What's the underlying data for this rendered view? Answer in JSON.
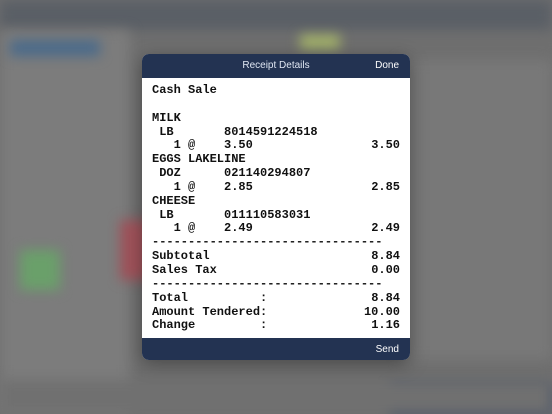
{
  "dialog": {
    "title": "Receipt Details",
    "done_label": "Done",
    "send_label": "Send"
  },
  "receipt": {
    "heading": "Cash Sale",
    "items": [
      {
        "name": "MILK",
        "unit_line": " LB       8014591224518",
        "qty_line": "   1 @    3.50",
        "total": "3.50"
      },
      {
        "name": "EGGS LAKELINE",
        "unit_line": " DOZ      021140294807",
        "qty_line": "   1 @    2.85",
        "total": "2.85"
      },
      {
        "name": "CHEESE",
        "unit_line": " LB       011110583031",
        "qty_line": "   1 @    2.49",
        "total": "2.49"
      }
    ],
    "separator": "--------------------------------",
    "subtotal_label": "Subtotal",
    "subtotal_value": "8.84",
    "tax_label": "Sales Tax",
    "tax_value": "0.00",
    "total_label": "Total          :",
    "total_value": "8.84",
    "tendered_label": "Amount Tendered:",
    "tendered_value": "10.00",
    "change_label": "Change         :",
    "change_value": "1.16"
  },
  "colors": {
    "header": "#233352",
    "body": "#ffffff"
  }
}
